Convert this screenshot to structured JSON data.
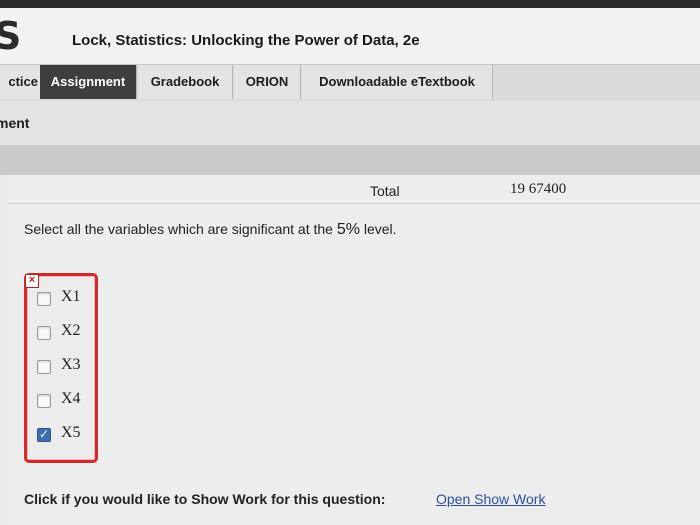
{
  "header": {
    "logo": "S",
    "course_title": "Lock, Statistics: Unlocking the Power of Data, 2e"
  },
  "tabs": [
    {
      "label": "ctice",
      "active": false
    },
    {
      "label": "Assignment",
      "active": true
    },
    {
      "label": "Gradebook",
      "active": false
    },
    {
      "label": "ORION",
      "active": false
    },
    {
      "label": "Downloadable eTextbook",
      "active": false
    }
  ],
  "subbar": {
    "title": "ment"
  },
  "table": {
    "total_label": "Total",
    "total_value": "19 67400"
  },
  "question": {
    "text_before": "Select all the variables which are significant at the ",
    "percent": "5%",
    "text_after": " level.",
    "incorrect_marker": "×",
    "options": [
      {
        "label": "X1",
        "checked": false
      },
      {
        "label": "X2",
        "checked": false
      },
      {
        "label": "X3",
        "checked": false
      },
      {
        "label": "X4",
        "checked": false
      },
      {
        "label": "X5",
        "checked": true
      }
    ]
  },
  "show_work": {
    "prompt": "Click if you would like to Show Work for this question:",
    "link": "Open Show Work"
  },
  "colors": {
    "active_tab": "#3e3e3e",
    "incorrect_border": "#d12a2a",
    "link": "#2f4f9a",
    "checked_box": "#3c6fb0"
  }
}
